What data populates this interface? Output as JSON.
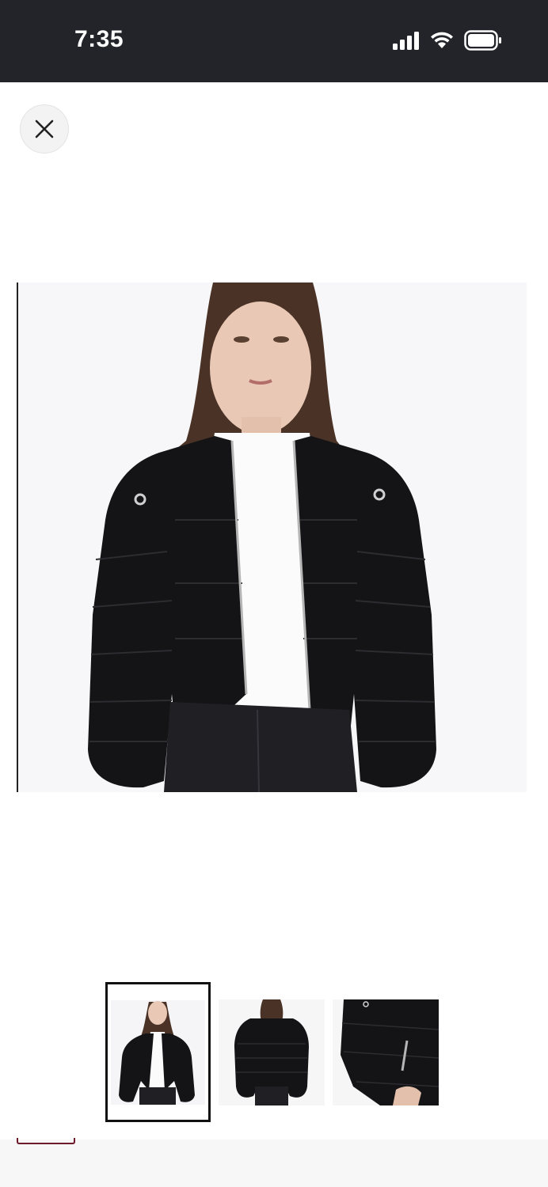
{
  "status_bar": {
    "time": "7:35"
  },
  "icons": {
    "close": "close-icon",
    "signal": "cellular-signal-icon",
    "wifi": "wifi-icon",
    "battery": "battery-icon"
  },
  "gallery": {
    "selected_index": 0,
    "thumbnails": [
      {
        "view": "front",
        "selected": true
      },
      {
        "view": "back",
        "selected": false
      },
      {
        "view": "detail",
        "selected": false
      }
    ]
  },
  "colors": {
    "status_bar_bg": "#23242a",
    "selected_border": "#111111",
    "accent_tab": "#6e1a2a"
  }
}
